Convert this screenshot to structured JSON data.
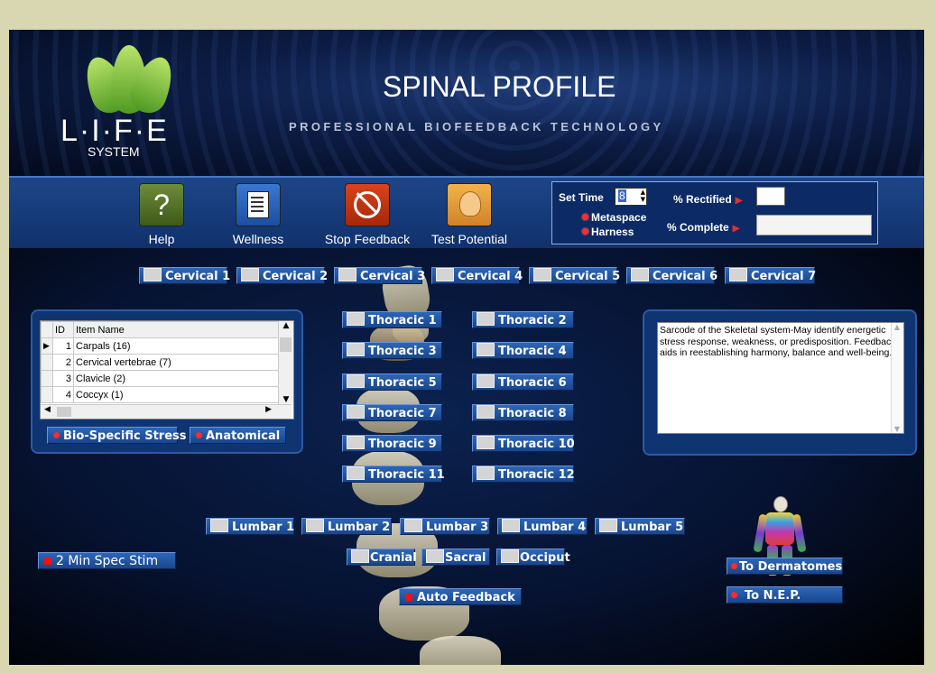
{
  "header": {
    "logo_text": "L·I·F·E",
    "logo_sub": "SYSTEM",
    "title": "SPINAL PROFILE",
    "subtitle": "PROFESSIONAL BIOFEEDBACK TECHNOLOGY"
  },
  "toolbar": {
    "help": "Help",
    "wellness": "Wellness",
    "stop_feedback": "Stop Feedback",
    "test_potential": "Test Potential",
    "set_time_label": "Set Time",
    "set_time_value": "8",
    "rectified_label": "% Rectified",
    "complete_label": "% Complete",
    "metaspace": "Metaspace",
    "harness": "Harness",
    "rectified_value": "",
    "complete_value": ""
  },
  "cervical": [
    "Cervical 1",
    "Cervical 2",
    "Cervical 3",
    "Cervical 4",
    "Cervical 5",
    "Cervical 6",
    "Cervical 7"
  ],
  "thoracic": [
    "Thoracic 1",
    "Thoracic 2",
    "Thoracic 3",
    "Thoracic 4",
    "Thoracic 5",
    "Thoracic 6",
    "Thoracic 7",
    "Thoracic 8",
    "Thoracic 9",
    "Thoracic 10",
    "Thoracic 11",
    "Thoracic 12"
  ],
  "lumbar": [
    "Lumbar 1",
    "Lumbar 2",
    "Lumbar 3",
    "Lumbar 4",
    "Lumbar 5"
  ],
  "other_regions": [
    "Cranial",
    "Sacral",
    "Occiput"
  ],
  "grid": {
    "columns": [
      "ID",
      "Item Name"
    ],
    "rows": [
      {
        "id": "1",
        "name": "Carpals (16)"
      },
      {
        "id": "2",
        "name": "Cervical vertebrae (7)"
      },
      {
        "id": "3",
        "name": "Clavicle (2)"
      },
      {
        "id": "4",
        "name": "Coccyx (1)"
      }
    ]
  },
  "left_options": {
    "bio_specific": "Bio-Specific Stress",
    "anatomical": "Anatomical"
  },
  "description": "Sarcode of the Skeletal system-May identify energetic stress response, weakness, or predisposition. Feedback aids in reestablishing harmony, balance and well-being.",
  "actions": {
    "spec_stim": "2 Min Spec Stim",
    "auto_feedback": "Auto Feedback",
    "dermatomes": "To Dermatomes",
    "nep": "To  N.E.P."
  },
  "colors": {
    "accent": "#1d4688",
    "button": "#2d66b8",
    "indicator": "#ff2a2a"
  }
}
